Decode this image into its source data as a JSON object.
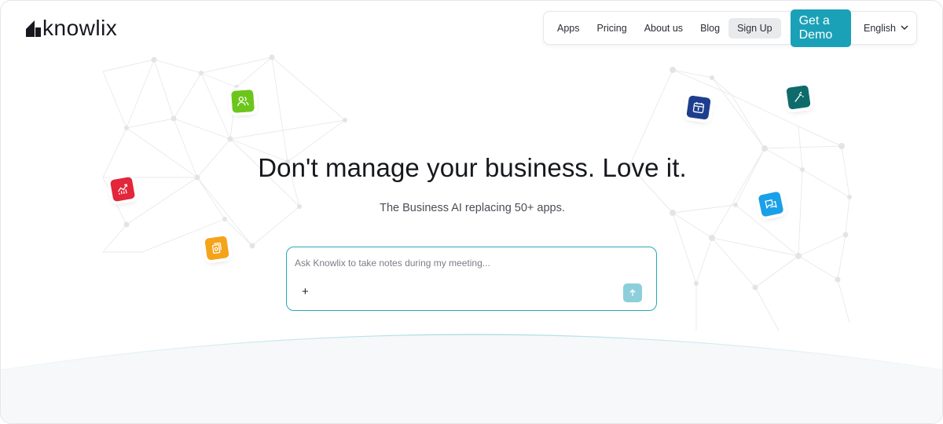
{
  "brand": {
    "name": "knowlix"
  },
  "nav": {
    "apps": "Apps",
    "pricing": "Pricing",
    "about": "About us",
    "blog": "Blog",
    "signup": "Sign Up",
    "demo": "Get a Demo",
    "language": "English"
  },
  "hero": {
    "title": "Don't manage your business. Love it.",
    "subtitle": "The Business AI replacing 50+ apps."
  },
  "prompt": {
    "placeholder": "Ask Knowlix to take notes during my meeting...",
    "value": "",
    "add_label": "+"
  },
  "colors": {
    "accent": "#1ba1b7",
    "people_icon": "#6cc51b",
    "chart_icon": "#e3263a",
    "files_icon": "#f5a319",
    "calendar_icon": "#1d3e8f",
    "magic_icon": "#0f6b6b",
    "chat_icon": "#1aa0e8"
  },
  "icons": [
    "people-icon",
    "chart-icon",
    "files-icon",
    "calendar-icon",
    "magic-wand-icon",
    "chat-icon"
  ]
}
